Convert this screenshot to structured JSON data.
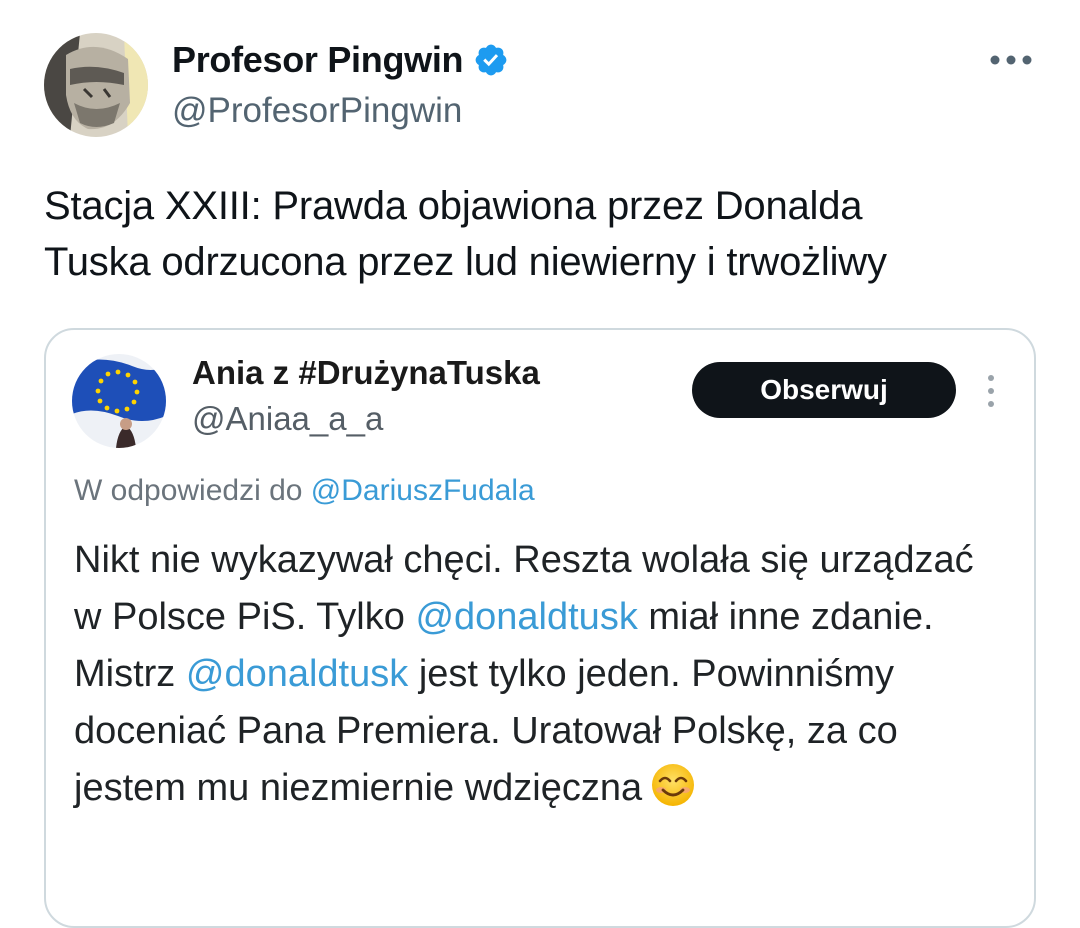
{
  "author": {
    "name": "Profesor Pingwin",
    "handle": "@ProfesorPingwin",
    "verified": true,
    "verified_color": "#1d9bf0"
  },
  "tweet": {
    "text_line1": "Stacja XXIII: Prawda objawiona przez Donalda",
    "text_line2": "Tuska odrzucona przez lud niewierny i trwożliwy"
  },
  "quote": {
    "name": "Ania z #DrużynaTuska",
    "handle": "@Aniaa_a_a",
    "follow_label": "Obserwuj",
    "reply_prefix": "W odpowiedzi do ",
    "reply_mention": "@DariuszFudala",
    "body": {
      "p1": "Nikt nie wykazywał chęci. Reszta wolała się urządzać w Polsce PiS. Tylko ",
      "mention1": "@donaldtusk",
      "p2": " miał inne zdanie. Mistrz ",
      "mention2": "@donaldtusk",
      "p3": " jest tylko jeden. Powinniśmy doceniać Pana Premiera. Uratował Polskę, za co jestem mu niezmiernie wdzięczna"
    },
    "mention_color": "#3a9bd6",
    "emoji": "smiling-face-icon"
  },
  "icons": {
    "more": "more-horizontal-icon",
    "verified": "verified-badge-icon",
    "kebab": "more-vertical-icon"
  }
}
